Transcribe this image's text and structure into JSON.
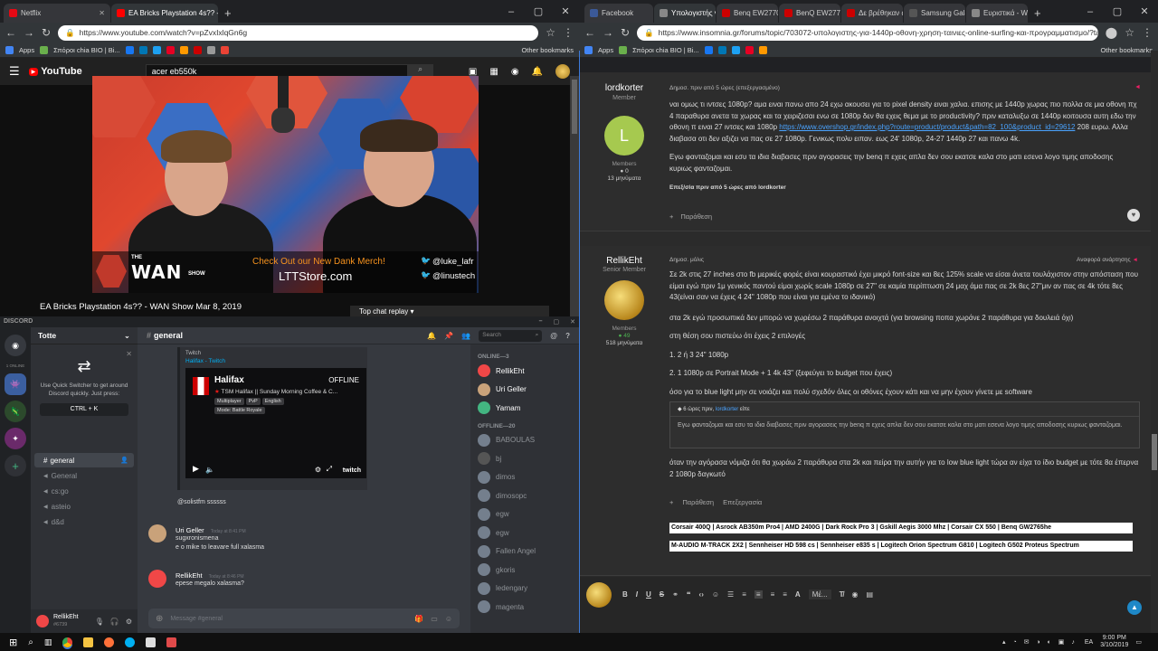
{
  "left_browser": {
    "tabs": [
      {
        "label": "Netflix",
        "color": "#e50914"
      },
      {
        "label": "EA Bricks Playstation 4s?? - W",
        "color": "#ff0000"
      }
    ],
    "url": "https://www.youtube.com/watch?v=pZvxIxlqGn6g",
    "apps_label": "Apps",
    "bookmark_first": "Σπόροι chia BIO | Bi...",
    "other_bookmarks": "Other bookmarks"
  },
  "youtube": {
    "logo": "YouTube",
    "search_value": "acer eb550k",
    "video_title": "EA Bricks Playstation 4s?? - WAN Show Mar 8, 2019",
    "top_chat": "Top chat replay",
    "overlay": {
      "the": "THE",
      "wan": "WAN",
      "show": "SHOW",
      "merch": "Check Out our New Dank Merch!",
      "store": "LTTStore.com",
      "handle1": "@luke_lafr",
      "handle2": "@linustech"
    }
  },
  "discord": {
    "app_title": "DISCORD",
    "online_count": "1 ONLINE",
    "server_name": "Totte",
    "quick_switch": "Use Quick Switcher to get around Discord quickly. Just press:",
    "quick_keys": "CTRL + K",
    "channels": [
      "general",
      "General",
      "cs:go",
      "asteio",
      "d&d"
    ],
    "channel_header": "general",
    "search_placeholder": "Search",
    "embed": {
      "provider": "Twitch",
      "author": "Halifax - Twitch",
      "name": "Halifax",
      "status": "OFFLINE",
      "stream_title": "TSM Halifax || Sunday Morning Coffee & C...",
      "tags": [
        "Multiplayer",
        "PvP",
        "English",
        "Mode: Battle Royale"
      ],
      "brand": "twitch"
    },
    "messages": [
      {
        "author": "",
        "time": "",
        "lines": [
          "@solistfm  ssssss"
        ]
      },
      {
        "author": "Uri Geller",
        "time": "Today at 8:41 PM",
        "lines": [
          "sugxronismena",
          "e o mike to leavare full xalasma"
        ]
      },
      {
        "author": "RellikEht",
        "time": "Today at 8:46 PM",
        "lines": [
          "epese megalo xalasma?"
        ]
      }
    ],
    "message_placeholder": "Message #general",
    "user": {
      "name": "RellikEht",
      "tag": "#6739"
    },
    "online_header": "ONLINE—3",
    "online_members": [
      {
        "name": "RellikEht",
        "color": "#f04747"
      },
      {
        "name": "Uri Geller",
        "color": "#b9bbbe"
      },
      {
        "name": "Yarnam",
        "color": "#b9bbbe"
      }
    ],
    "offline_header": "OFFLINE—20",
    "offline_members": [
      "BABOULAS",
      "bj",
      "dimos",
      "dimosopc",
      "egw",
      "egw",
      "Fallen Angel",
      "gkoris",
      "ledengary",
      "magenta"
    ]
  },
  "right_browser": {
    "tabs": [
      {
        "label": "Facebook",
        "color": "#3b5998"
      },
      {
        "label": "Υπολογιστής γι...",
        "color": "#888888"
      },
      {
        "label": "Benq EW2770Q...",
        "color": "#c00000"
      },
      {
        "label": "BenQ EW277HD...",
        "color": "#c00000"
      },
      {
        "label": "Δε βρέθηκαν απ...",
        "color": "#c00000"
      },
      {
        "label": "Samsung Galax...",
        "color": "#555555"
      },
      {
        "label": "Ευριστικά - Win...",
        "color": "#888888"
      }
    ],
    "url": "https://www.insomnia.gr/forums/topic/703072-υπολογιστης-για-1440p-οθονη-χρηση-ταινιες-online-surfing-και-προγραμματισμο/?tab=comm...",
    "apps_label": "Apps",
    "bookmark_first": "Σπόροι chia BIO | Bi...",
    "other_bookmarks": "Other bookmarks"
  },
  "forum": {
    "post1": {
      "author": "lordkorter",
      "rank": "Member",
      "avatar_letter": "L",
      "group": "Members",
      "rep": "0",
      "posts": "13 μηνύματα",
      "meta": "Δημοσ. πριν από 5 ώρες (επεξεργασμένο)",
      "p1": "ναι ομως τι ιντσες 1080p? αμα ειναι πανω απο 24 εχω ακουσει για το pixel density ειναι χαλια. επισης με 1440p χωρας πιο πολλα σε μια οθονη πχ 4 παραθυρα ανετα τα χωρας και τα χειριζεσαι ενω σε 1080p δεν θα εχεις θεμα με  το productivity? πριν καταλυξω σε 1440p κοιτουσα αυτη εδω την οθονη π ειναι 27 ιντσες και 1080p",
      "link": "https://www.overshop.gr/index.php?route=product/product&path=82_100&product_id=29612",
      "p1_end": "208 ευρω. Αλλα διαβασα οτι δεν αξιζει να πας σε 27 1080p. Γενικως πολυ ειπαν. εως 24' 1080p, 24-27 1440p 27 και πανω 4k.",
      "p2": "Εγω φανταζομαι και εσυ τα ιδια διαβασες πριν αγορασεις την benq π εχεις απλα δεν σου εκατσε καλα στο ματι εσενα λογο τιμης αποδοσης κυριως φανταζομαι.",
      "edit_note": "Επεξ/σία πριν από 5 ώρες από lordkorter",
      "quote_btn": "Παράθεση"
    },
    "post2": {
      "author": "RellikEht",
      "rank": "Senior Member",
      "group": "Members",
      "rep": "49",
      "posts": "518 μηνύματα",
      "meta": "Δημοσ. μόλις",
      "report": "Αναφορά ανάρτησης",
      "p1": "Σε 2k στις 27 inches στο fb μερικές φορές είναι κουραστικό έχει μικρό font-size και 8ες 125% scale να είσαι άνετα τουλάχιστον στην απόσταση που είμαι εγώ πριν 1μ γενικός παντού είμαι χωρίς scale 1080p σε 27\" σε καμία περίπτωση 24 μαχ άμα πας σε 2k 8ες 27\"μιν  αν πας σε 4k τότε 8ες 43(είναι σαν να έχεις 4 24\" 1080p που είναι για εμένα το ιδανικό)",
      "p2": "στα 2k εγώ προσωπικά δεν μπορώ να χωρέσω 2 παράθυρα ανοιχτά (για browsing ποπα χωράνε 2 παράθυρα για δουλειά όχι)",
      "p3": "στη θέση σου πιστεύω ότι έχεις 2 επιλογές",
      "p4": "1. 2 ή 3   24\" 1080p",
      "p5": "2. 1 1080p σε Portrait Mode + 1 4k 43\" (ξεφεύγει το budget που έχεις)",
      "p6": "όσο για το blue light  μην σε νοιάζει και πολύ σχεδόν όλες οι οθόνες έχουν κάτι και να μην έχουν γίνετε με software",
      "quote_head": "6 ώρες πριν,",
      "quote_author": "lordkorter",
      "quote_says": "είπε",
      "quote_text": "Εγω φανταζομαι και εσυ τα ιδια διαβασες πριν αγορασεις την benq π εχεις απλα δεν σου εκατσε καλα στο ματι εσενα λογο τιμης αποδοσης κυριως φανταζομαι.",
      "p7": "όταν την αγόρασα νόμιζα ότι θα χωράω 2 παράθυρα στα 2k  και πείρα την αυτήν για το low blue light τώρα αν είχα το ίδιο budget με τότε 8α έπερνα 2 1080p δαγκωτό",
      "quote_btn": "Παράθεση",
      "edit_btn": "Επεξεργασία",
      "sig1": "Corsair 400Q | Asrock AB350m Pro4 | AMD 2400G | Dark Rock Pro 3 | Gskill Aegis 3000 Mhz | Corsair CX 550 | Benq GW2765he",
      "sig2": "M-AUDIO M-TRACK 2X2 | Sennheiser HD 598 cs | Sennheiser e835 s | Logitech Orion Spectrum G810 | Logitech G502 Proteus Spectrum"
    },
    "editor_font": "Μέ..."
  },
  "taskbar": {
    "time": "9:00 PM",
    "date": "3/10/2019",
    "lang": "EA"
  }
}
